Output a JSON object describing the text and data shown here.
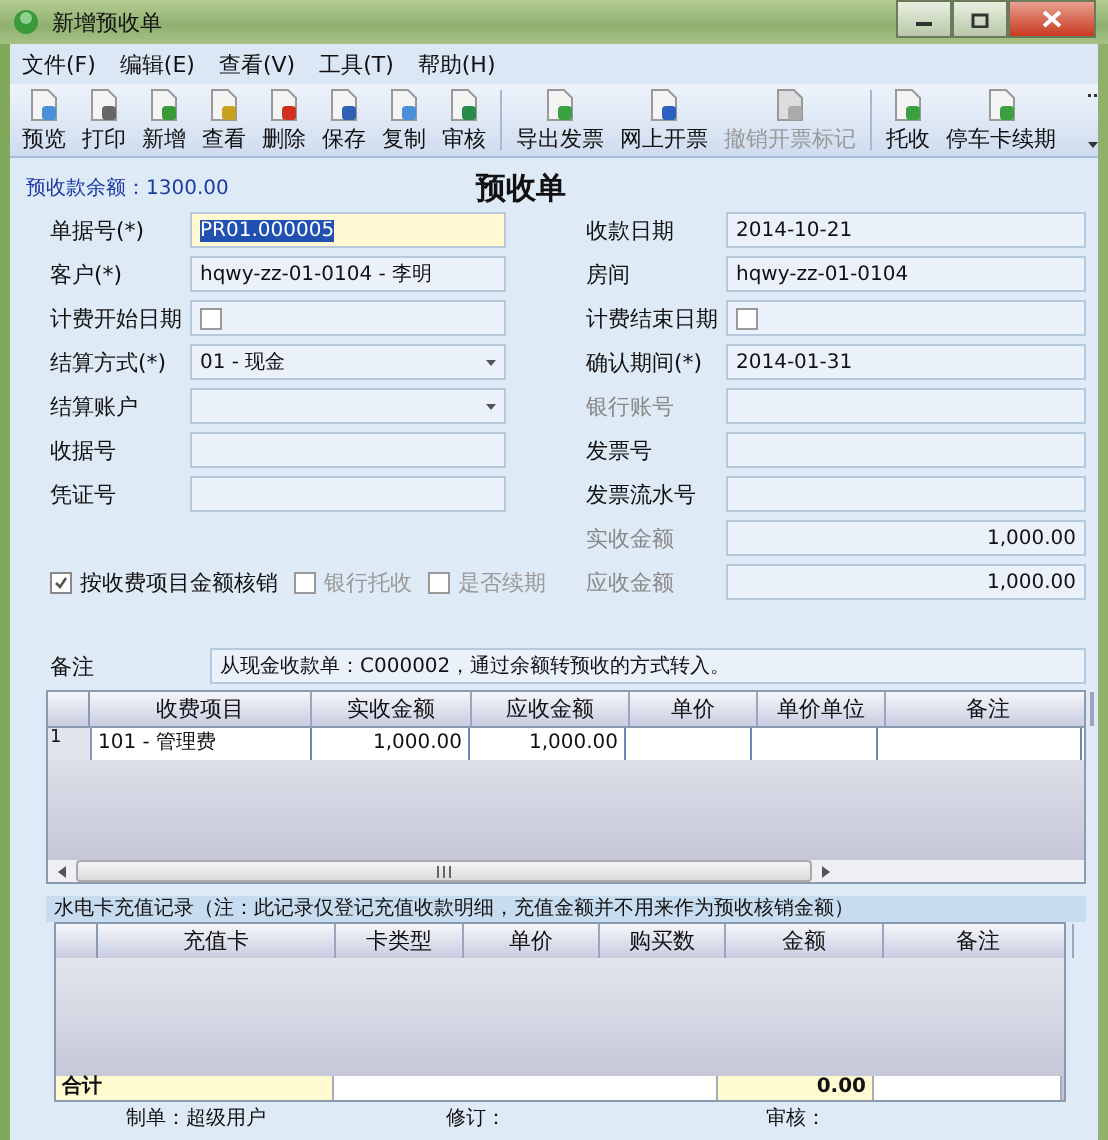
{
  "window": {
    "title": "新增预收单"
  },
  "menu": [
    "文件(F)",
    "编辑(E)",
    "查看(V)",
    "工具(T)",
    "帮助(H)"
  ],
  "toolbar_groups": [
    {
      "buttons": [
        {
          "label": "预览",
          "disabled": false
        },
        {
          "label": "打印",
          "disabled": false
        },
        {
          "label": "新增",
          "disabled": false
        },
        {
          "label": "查看",
          "disabled": false
        },
        {
          "label": "删除",
          "disabled": false
        },
        {
          "label": "保存",
          "disabled": false
        },
        {
          "label": "复制",
          "disabled": false
        },
        {
          "label": "审核",
          "disabled": false
        }
      ]
    },
    {
      "buttons": [
        {
          "label": "导出发票",
          "disabled": false
        },
        {
          "label": "网上开票",
          "disabled": false
        },
        {
          "label": "撤销开票标记",
          "disabled": true
        }
      ]
    },
    {
      "buttons": [
        {
          "label": "托收",
          "disabled": false
        },
        {
          "label": "停车卡续期",
          "disabled": false
        }
      ]
    }
  ],
  "balance": "预收款余额：1300.00",
  "form_title": "预收单",
  "left_fields": [
    {
      "label": "单据号(*)",
      "kind": "text",
      "value": "PR01.000005",
      "disabled": false,
      "focused": true
    },
    {
      "label": "客户(*)",
      "kind": "text",
      "value": "hqwy-zz-01-0104 - 李明",
      "disabled": false,
      "focused": false
    },
    {
      "label": "计费开始日期",
      "kind": "checkbox",
      "checked": false,
      "disabled": false,
      "focused": false
    },
    {
      "label": "结算方式(*)",
      "kind": "select",
      "value": "01 - 现金",
      "disabled": false,
      "focused": false
    },
    {
      "label": "结算账户",
      "kind": "select",
      "disabled": false,
      "focused": false
    },
    {
      "label": "收据号",
      "kind": "text",
      "disabled": false,
      "focused": false
    },
    {
      "label": "凭证号",
      "kind": "text",
      "disabled": false,
      "focused": false
    }
  ],
  "right_fields": [
    {
      "label": "收款日期",
      "kind": "text",
      "value": "2014-10-21",
      "disabled": false,
      "focused": false
    },
    {
      "label": "房间",
      "kind": "text",
      "value": "hqwy-zz-01-0104",
      "disabled": false,
      "focused": false
    },
    {
      "label": "计费结束日期",
      "kind": "checkbox",
      "checked": false,
      "disabled": false,
      "focused": false
    },
    {
      "label": "确认期间(*)",
      "kind": "text",
      "value": "2014-01-31",
      "disabled": false,
      "focused": false
    },
    {
      "label": "银行账号",
      "kind": "text",
      "disabled": true,
      "focused": false
    },
    {
      "label": "发票号",
      "kind": "text",
      "disabled": false,
      "focused": false
    },
    {
      "label": "发票流水号",
      "kind": "text",
      "disabled": false,
      "focused": false
    },
    {
      "label": "实收金额",
      "kind": "amount",
      "value": "1,000.00",
      "disabled": true,
      "focused": false
    },
    {
      "label": "应收金额",
      "kind": "amount",
      "value": "1,000.00",
      "disabled": true,
      "focused": false
    }
  ],
  "options": [
    {
      "label": "按收费项目金额核销",
      "checked": true,
      "disabled": false
    },
    {
      "label": "银行托收",
      "checked": false,
      "disabled": true
    },
    {
      "label": "是否续期",
      "checked": false,
      "disabled": true
    }
  ],
  "remark": {
    "label": "备注",
    "value": "从现金收款单：C000002，通过余额转预收的方式转入。"
  },
  "items_table": {
    "columns": [
      "收费项目",
      "实收金额",
      "应收金额",
      "单价",
      "单价单位",
      "备注"
    ],
    "rows": [
      {
        "number": "1",
        "item": "101 - 管理费",
        "received": "1,000.00",
        "receivable": "1,000.00"
      }
    ]
  },
  "card_section": {
    "title": "水电卡充值记录（注：此记录仅登记充值收款明细，充值金额并不用来作为预收核销金额）",
    "columns": [
      "充值卡",
      "卡类型",
      "单价",
      "购买数",
      "金额",
      "备注"
    ],
    "total_label": "合计",
    "total_amount": "0.00"
  },
  "footer": [
    "制单：超级用户",
    "修订：",
    "审核："
  ]
}
